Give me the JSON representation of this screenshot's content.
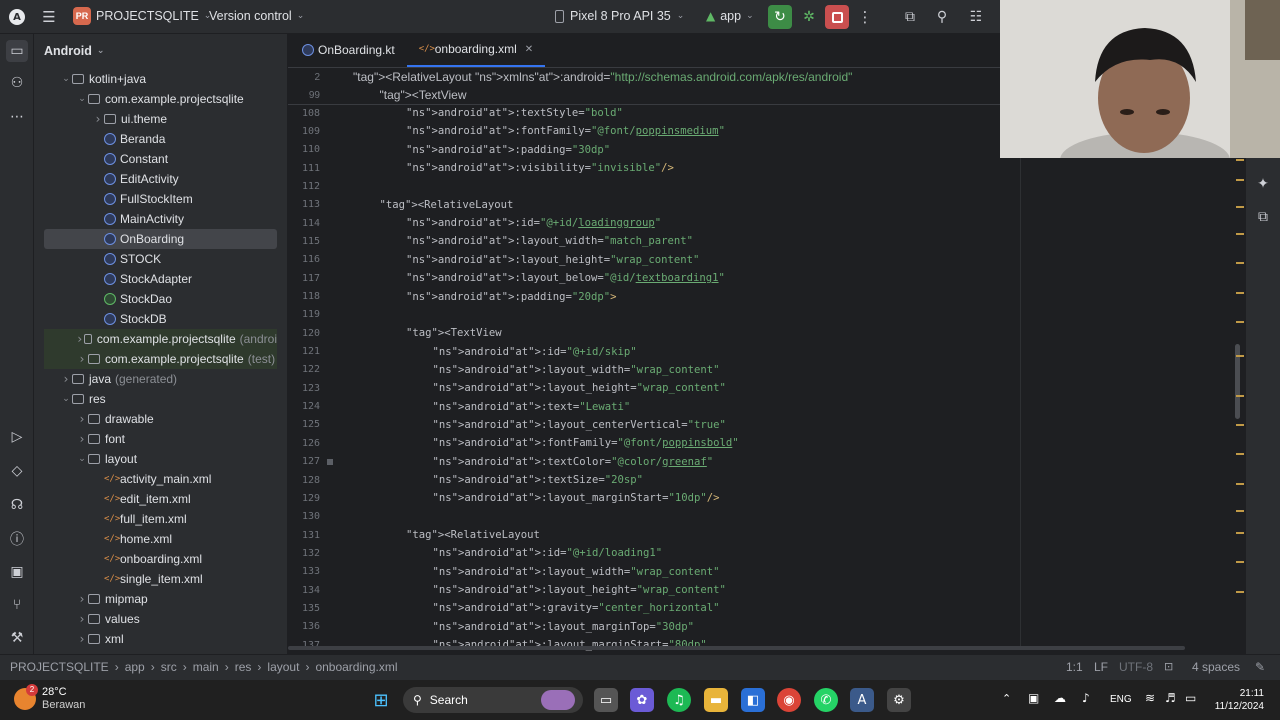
{
  "topbar": {
    "project_badge": "PR",
    "project_name": "PROJECTSQLITE",
    "version_control": "Version control",
    "device": "Pixel 8 Pro API 35",
    "run_config": "app"
  },
  "project_panel": {
    "title": "Android",
    "items": [
      {
        "label": "kotlin+java",
        "extra": ""
      },
      {
        "label": "com.example.projectsqlite",
        "extra": ""
      },
      {
        "label": "ui.theme",
        "extra": ""
      },
      {
        "label": "Beranda",
        "extra": ""
      },
      {
        "label": "Constant",
        "extra": ""
      },
      {
        "label": "EditActivity",
        "extra": ""
      },
      {
        "label": "FullStockItem",
        "extra": ""
      },
      {
        "label": "MainActivity",
        "extra": ""
      },
      {
        "label": "OnBoarding",
        "extra": ""
      },
      {
        "label": "STOCK",
        "extra": ""
      },
      {
        "label": "StockAdapter",
        "extra": ""
      },
      {
        "label": "StockDao",
        "extra": ""
      },
      {
        "label": "StockDB",
        "extra": ""
      },
      {
        "label": "com.example.projectsqlite",
        "extra": "(androi"
      },
      {
        "label": "com.example.projectsqlite",
        "extra": "(test)"
      },
      {
        "label": "java",
        "extra": "(generated)"
      },
      {
        "label": "res",
        "extra": ""
      },
      {
        "label": "drawable",
        "extra": ""
      },
      {
        "label": "font",
        "extra": ""
      },
      {
        "label": "layout",
        "extra": ""
      },
      {
        "label": "activity_main.xml",
        "extra": ""
      },
      {
        "label": "edit_item.xml",
        "extra": ""
      },
      {
        "label": "full_item.xml",
        "extra": ""
      },
      {
        "label": "home.xml",
        "extra": ""
      },
      {
        "label": "onboarding.xml",
        "extra": ""
      },
      {
        "label": "single_item.xml",
        "extra": ""
      },
      {
        "label": "mipmap",
        "extra": ""
      },
      {
        "label": "values",
        "extra": ""
      },
      {
        "label": "xml",
        "extra": ""
      }
    ]
  },
  "tabs": [
    {
      "label": "OnBoarding.kt"
    },
    {
      "label": "onboarding.xml"
    }
  ],
  "sticky_lines": [
    {
      "num": "2",
      "text": "<RelativeLayout xmlns:android=\"http://schemas.android.com/apk/res/android\""
    },
    {
      "num": "99",
      "text": "<TextView"
    }
  ],
  "code_lines": [
    {
      "num": "108",
      "text": "android:textStyle=\"bold\""
    },
    {
      "num": "109",
      "text": "android:fontFamily=\"@font/poppinsmedium\""
    },
    {
      "num": "110",
      "text": "android:padding=\"30dp\""
    },
    {
      "num": "111",
      "text": "android:visibility=\"invisible\"/>"
    },
    {
      "num": "112",
      "text": ""
    },
    {
      "num": "113",
      "text": "<RelativeLayout"
    },
    {
      "num": "114",
      "text": "android:id=\"@+id/loadinggroup\""
    },
    {
      "num": "115",
      "text": "android:layout_width=\"match_parent\""
    },
    {
      "num": "116",
      "text": "android:layout_height=\"wrap_content\""
    },
    {
      "num": "117",
      "text": "android:layout_below=\"@id/textboarding1\""
    },
    {
      "num": "118",
      "text": "android:padding=\"20dp\">"
    },
    {
      "num": "119",
      "text": ""
    },
    {
      "num": "120",
      "text": "<TextView"
    },
    {
      "num": "121",
      "text": "android:id=\"@+id/skip\""
    },
    {
      "num": "122",
      "text": "android:layout_width=\"wrap_content\""
    },
    {
      "num": "123",
      "text": "android:layout_height=\"wrap_content\""
    },
    {
      "num": "124",
      "text": "android:text=\"Lewati\""
    },
    {
      "num": "125",
      "text": "android:layout_centerVertical=\"true\""
    },
    {
      "num": "126",
      "text": "android:fontFamily=\"@font/poppinsbold\""
    },
    {
      "num": "127",
      "text": "android:textColor=\"@color/greenaf\""
    },
    {
      "num": "128",
      "text": "android:textSize=\"20sp\""
    },
    {
      "num": "129",
      "text": "android:layout_marginStart=\"10dp\"/>"
    },
    {
      "num": "130",
      "text": ""
    },
    {
      "num": "131",
      "text": "<RelativeLayout"
    },
    {
      "num": "132",
      "text": "android:id=\"@+id/loading1\""
    },
    {
      "num": "133",
      "text": "android:layout_width=\"wrap_content\""
    },
    {
      "num": "134",
      "text": "android:layout_height=\"wrap_content\""
    },
    {
      "num": "135",
      "text": "android:gravity=\"center_horizontal\""
    },
    {
      "num": "136",
      "text": "android:layout_marginTop=\"30dp\""
    },
    {
      "num": "137",
      "text": "android:layout_marginStart=\"80dp\""
    }
  ],
  "statusbar": {
    "breadcrumbs": [
      "PROJECTSQLITE",
      "app",
      "src",
      "main",
      "res",
      "layout",
      "onboarding.xml"
    ],
    "position": "1:1",
    "line_sep": "LF",
    "encoding": "UTF-8",
    "indent": "4 spaces"
  },
  "taskbar": {
    "weather_badge": "2",
    "temp": "28°C",
    "weather": "Berawan",
    "search": "Search",
    "lang": "ENG",
    "time": "21:11",
    "date": "11/12/2024"
  },
  "colors": {
    "accent": "#3574f0",
    "run_green": "#5fb865",
    "stop_red": "#db5c5c",
    "xml_tag": "#d5b778",
    "xml_ns": "#c77dbb",
    "xml_value": "#6aab73"
  }
}
